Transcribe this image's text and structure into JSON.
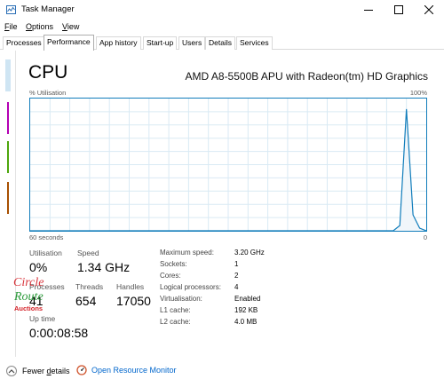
{
  "window": {
    "title": "Task Manager",
    "icon": "task-manager-icon"
  },
  "menu": {
    "file": {
      "u": "F",
      "rest": "ile"
    },
    "options": {
      "u": "O",
      "rest": "ptions"
    },
    "view": {
      "u": "V",
      "rest": "iew"
    }
  },
  "tabs": [
    "Processes",
    "Performance",
    "App history",
    "Start-up",
    "Users",
    "Details",
    "Services"
  ],
  "active_tab": "Performance",
  "cpu": {
    "heading": "CPU",
    "model": "AMD A8-5500B APU with Radeon(tm) HD Graphics",
    "graph": {
      "y_label": "% Utilisation",
      "y_max_label": "100%",
      "x_left_label": "60 seconds",
      "x_right_label": "0",
      "line_color": "#117dbb",
      "fill_color": "#f1f6fa",
      "grid_color": "#d9eaf4",
      "series": [
        0,
        0,
        0,
        0,
        0,
        0,
        0,
        0,
        0,
        0,
        0,
        0,
        0,
        0,
        0,
        0,
        0,
        0,
        0,
        0,
        0,
        0,
        0,
        0,
        0,
        0,
        0,
        0,
        0,
        0,
        0,
        0,
        0,
        0,
        0,
        0,
        0,
        0,
        0,
        0,
        0,
        0,
        0,
        0,
        0,
        0,
        0,
        0,
        0,
        0,
        0,
        0,
        0,
        0,
        0,
        0,
        4,
        92,
        12,
        2,
        0
      ]
    },
    "stats": {
      "utilisation_label": "Utilisation",
      "utilisation_value": "0%",
      "speed_label": "Speed",
      "speed_value": "1.34 GHz",
      "processes_label": "Processes",
      "processes_value": "41",
      "threads_label": "Threads",
      "threads_value": "654",
      "handles_label": "Handles",
      "handles_value": "17050",
      "uptime_label": "Up time",
      "uptime_value": "0:00:08:58"
    },
    "info": [
      {
        "label": "Maximum speed:",
        "value": "3.20 GHz"
      },
      {
        "label": "Sockets:",
        "value": "1"
      },
      {
        "label": "Cores:",
        "value": "2"
      },
      {
        "label": "Logical processors:",
        "value": "4"
      },
      {
        "label": "Virtualisation:",
        "value": "Enabled"
      },
      {
        "label": "L1 cache:",
        "value": "192 KB"
      },
      {
        "label": "L2 cache:",
        "value": "4.0 MB"
      }
    ]
  },
  "watermark": {
    "line1": "Circle",
    "line2": "Route",
    "line3": "Auctions"
  },
  "footer": {
    "fewer_details_u": "d",
    "fewer_details_pre": "Fewer ",
    "fewer_details_post": "etails",
    "open_monitor": "Open Resource Monitor"
  },
  "left_pane_colors": [
    "#cfe5f3",
    "#b400b4",
    "#4da60c",
    "#a74f01"
  ]
}
